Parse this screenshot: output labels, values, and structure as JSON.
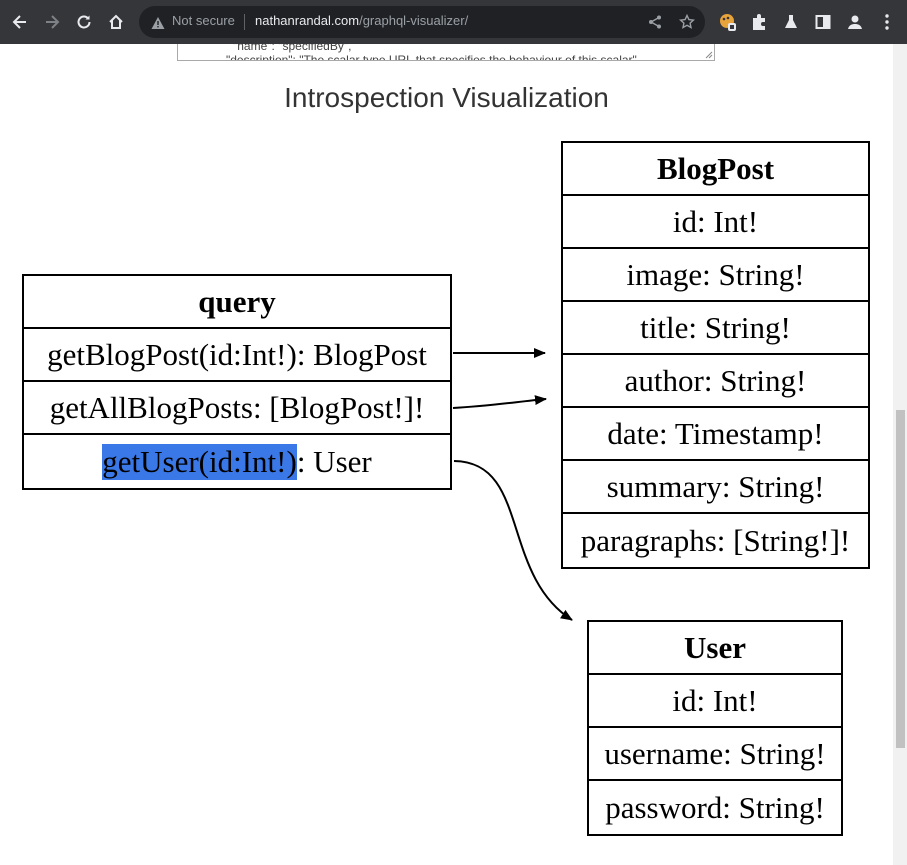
{
  "browser": {
    "security_label": "Not secure",
    "url_domain": "nathanrandal.com",
    "url_path": "/graphql-visualizer/",
    "icons": [
      "back-icon",
      "forward-icon",
      "reload-icon",
      "home-icon",
      "warning-icon",
      "share-icon",
      "star-icon",
      "extension-icon",
      "puzzle-icon",
      "labs-icon",
      "sidepanel-icon",
      "profile-icon",
      "menu-icon"
    ]
  },
  "textarea": {
    "line1": "\"name\": \"specifiedBy\",",
    "line2": "\"description\": \"The scalar type URL that specifies the behaviour of this scalar\","
  },
  "page": {
    "title": "Introspection Visualization"
  },
  "query_type": {
    "name": "query",
    "fields": [
      "getBlogPost(id:Int!): BlogPost",
      "getAllBlogPosts: [BlogPost!]!"
    ],
    "user_field_selected": "getUser(id:Int!)",
    "user_field_rest": ": User"
  },
  "blogpost_type": {
    "name": "BlogPost",
    "fields": [
      "id: Int!",
      "image: String!",
      "title: String!",
      "author: String!",
      "date: Timestamp!",
      "summary: String!",
      "paragraphs: [String!]!"
    ]
  },
  "user_type": {
    "name": "User",
    "fields": [
      "id: Int!",
      "username: String!",
      "password: String!"
    ]
  },
  "colors": {
    "selection": "#3b78e7",
    "chrome": "#35363a",
    "omnibox": "#202124"
  }
}
